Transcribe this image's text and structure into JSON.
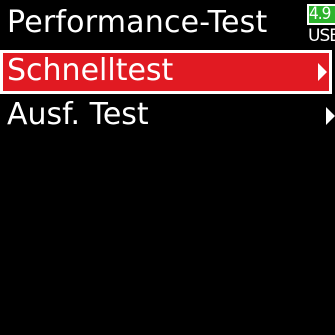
{
  "header": {
    "title": "Performance-Test"
  },
  "battery": {
    "value": "4.9",
    "source": "USB",
    "fill_color": "#2db32d"
  },
  "menu": {
    "items": [
      {
        "label": "Schnelltest",
        "selected": true,
        "icon": "chevron-right-icon"
      },
      {
        "label": "Ausf. Test",
        "selected": false,
        "icon": "chevron-right-icon"
      }
    ]
  },
  "colors": {
    "background": "#000000",
    "selection": "#e11a22",
    "text": "#ffffff"
  }
}
